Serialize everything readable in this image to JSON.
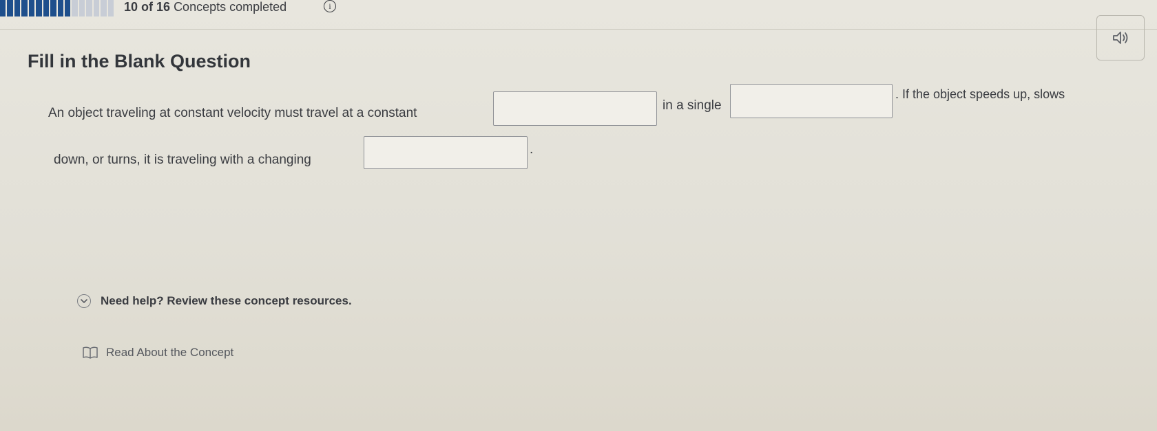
{
  "header": {
    "progress_count": "10 of 16",
    "progress_label": "Concepts completed",
    "progress_fraction": 0.625,
    "info_icon_glyph": "i",
    "audio_icon": "speaker-icon"
  },
  "question": {
    "title": "Fill in the Blank Question",
    "text_part_1": "An object traveling at constant velocity must travel at a constant",
    "text_part_2": "in a single",
    "text_part_3": ". If the object speeds up, slows",
    "text_part_4": "down, or turns, it is traveling with a changing",
    "text_part_5": ".",
    "blanks": [
      {
        "value": ""
      },
      {
        "value": ""
      },
      {
        "value": ""
      }
    ]
  },
  "help": {
    "toggle_label": "Need help? Review these concept resources.",
    "toggle_icon": "chevron-down-icon",
    "resources": [
      {
        "label": "Read About the Concept",
        "icon": "book-icon"
      }
    ]
  },
  "colors": {
    "progress_fill": "#1e4f8c",
    "background": "#e3e1d8",
    "text": "#3a3c41"
  }
}
